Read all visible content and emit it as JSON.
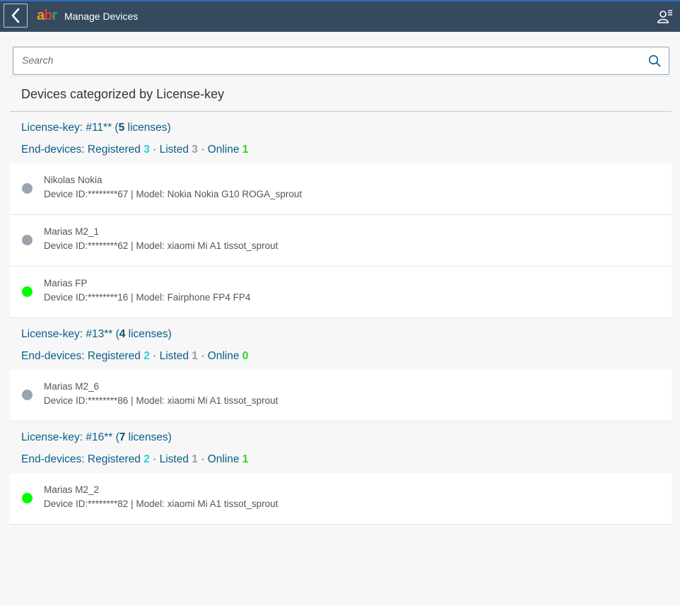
{
  "header": {
    "logo_parts": [
      "a",
      "b",
      "r"
    ],
    "title": "Manage Devices",
    "icons": {
      "back": "chevron-left-icon",
      "user": "user-menu-icon"
    }
  },
  "search": {
    "placeholder": "Search",
    "value": "",
    "icon": "search-icon"
  },
  "section_title": "Devices categorized by License-key",
  "colors": {
    "shell": "#354a5f",
    "link_text": "#0b5e8a",
    "registered": "#3ac9e3",
    "listed": "#95a0a8",
    "online": "#2bd620",
    "status_online": "#00ff00",
    "status_offline": "#9aa4ad"
  },
  "groups": [
    {
      "lk_prefix": "License-key: ",
      "key": "#11**",
      "lk_open": " (",
      "count": "5",
      "lk_suffix": " licenses)",
      "ed_label": "End-devices: ",
      "reg_label": "Registered ",
      "registered": "3",
      "sep1": " · ",
      "list_label": "Listed ",
      "listed": "3",
      "sep2": " · ",
      "online_label": "Online ",
      "online": "1",
      "devices": [
        {
          "name": "Nikolas Nokia",
          "info": "Device ID:********67 | Model: Nokia Nokia G10 ROGA_sprout",
          "status": "offline"
        },
        {
          "name": "Marias M2_1",
          "info": "Device ID:********62 | Model: xiaomi Mi A1 tissot_sprout",
          "status": "offline"
        },
        {
          "name": "Marias FP",
          "info": "Device ID:********16 | Model: Fairphone FP4 FP4",
          "status": "online"
        }
      ]
    },
    {
      "lk_prefix": "License-key: ",
      "key": "#13**",
      "lk_open": " (",
      "count": "4",
      "lk_suffix": " licenses)",
      "ed_label": "End-devices: ",
      "reg_label": "Registered ",
      "registered": "2",
      "sep1": " · ",
      "list_label": "Listed ",
      "listed": "1",
      "sep2": " · ",
      "online_label": "Online ",
      "online": "0",
      "devices": [
        {
          "name": "Marias M2_6",
          "info": "Device ID:********86 | Model: xiaomi Mi A1 tissot_sprout",
          "status": "offline"
        }
      ]
    },
    {
      "lk_prefix": "License-key: ",
      "key": "#16**",
      "lk_open": " (",
      "count": "7",
      "lk_suffix": " licenses)",
      "ed_label": "End-devices: ",
      "reg_label": "Registered ",
      "registered": "2",
      "sep1": " · ",
      "list_label": "Listed ",
      "listed": "1",
      "sep2": " · ",
      "online_label": "Online ",
      "online": "1",
      "devices": [
        {
          "name": "Marias M2_2",
          "info": "Device ID:********82 | Model: xiaomi Mi A1 tissot_sprout",
          "status": "online"
        }
      ]
    }
  ]
}
